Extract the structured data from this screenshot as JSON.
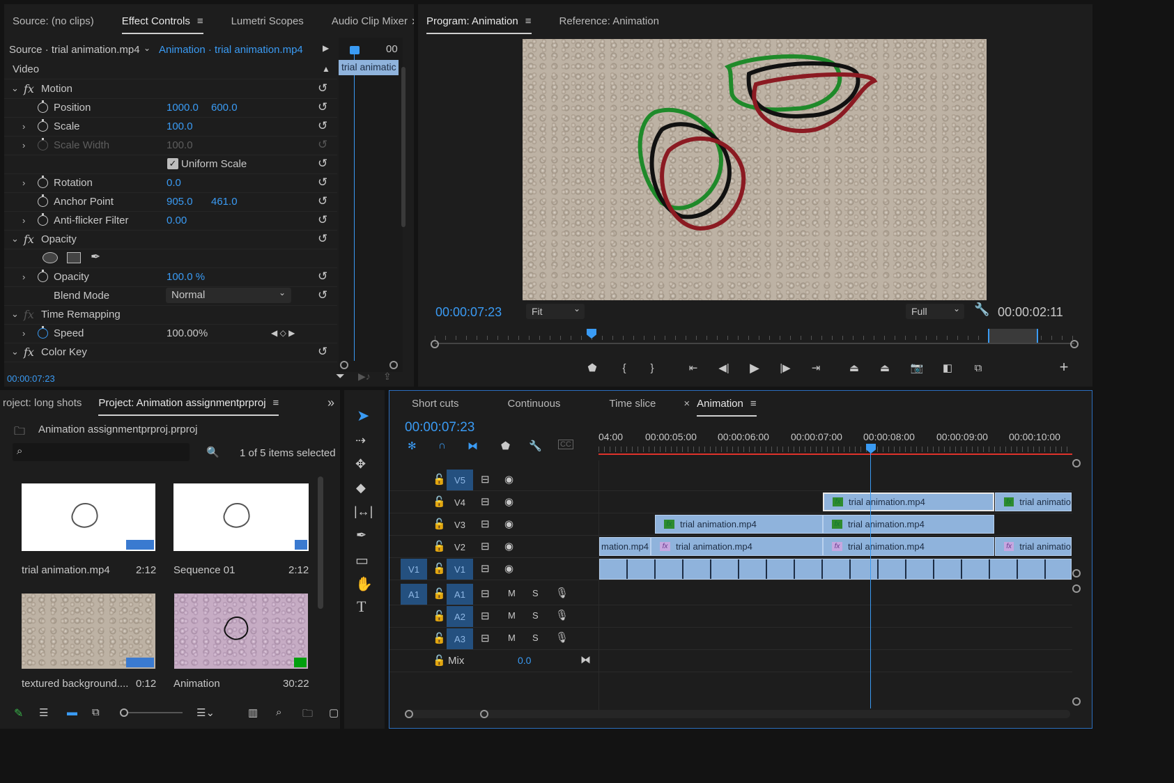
{
  "effect_panel": {
    "tabs": [
      "Source: (no clips)",
      "Effect Controls",
      "Lumetri Scopes",
      "Audio Clip Mixer"
    ],
    "overflow": "»",
    "source_label": "Source · trial animation.mp4",
    "seq_label": "Animation · trial animation.mp4",
    "mini_time": "00",
    "clip_label": "trial animatic",
    "section": "Video",
    "motion": "Motion",
    "position_label": "Position",
    "position_x": "1000.0",
    "position_y": "600.0",
    "scale_label": "Scale",
    "scale_val": "100.0",
    "scale_width_label": "Scale Width",
    "scale_width_val": "100.0",
    "uniform_label": "Uniform Scale",
    "rotation_label": "Rotation",
    "rotation_val": "0.0",
    "anchor_label": "Anchor Point",
    "anchor_x": "905.0",
    "anchor_y": "461.0",
    "antiflicker_label": "Anti-flicker Filter",
    "antiflicker_val": "0.00",
    "opacity_section": "Opacity",
    "opacity_label": "Opacity",
    "opacity_val": "100.0 %",
    "blend_label": "Blend Mode",
    "blend_val": "Normal",
    "time_remap": "Time Remapping",
    "speed_label": "Speed",
    "speed_val": "100.00%",
    "color_key": "Color Key",
    "timecode": "00:00:07:23"
  },
  "program_panel": {
    "tabs": [
      "Program: Animation",
      "Reference: Animation"
    ],
    "timecode": "00:00:07:23",
    "fit": "Fit",
    "quality": "Full",
    "duration": "00:00:02:11"
  },
  "project_panel": {
    "tabs": [
      "roject: long shots",
      "Project: Animation assignmentprproj"
    ],
    "overflow": "»",
    "file_name": "Animation assignmentprproj.prproj",
    "selected": "1 of 5 items selected",
    "items": [
      {
        "name": "trial animation.mp4",
        "duration": "2:12"
      },
      {
        "name": "Sequence 01",
        "duration": "2:12"
      },
      {
        "name": "textured background....",
        "duration": "0:12"
      },
      {
        "name": "Animation",
        "duration": "30:22"
      }
    ]
  },
  "timeline_panel": {
    "tabs": [
      "Short cuts",
      "Continuous",
      "Time slice",
      "Animation"
    ],
    "close": "×",
    "timecode": "00:00:07:23",
    "ruler": [
      "04:00",
      "00:00:05:00",
      "00:00:06:00",
      "00:00:07:00",
      "00:00:08:00",
      "00:00:09:00",
      "00:00:10:00"
    ],
    "video_tracks": [
      "V5",
      "V4",
      "V3",
      "V2",
      "V1"
    ],
    "source_v": "V1",
    "audio_tracks": [
      "A1",
      "A2",
      "A3"
    ],
    "source_a": "A1",
    "mute": "M",
    "solo": "S",
    "mix_label": "Mix",
    "mix_val": "0.0",
    "clip_name": "trial animation.mp4",
    "clip_short": "trial animatio",
    "clip_cut": "mation.mp4"
  },
  "colors": {
    "accent": "#3a9bf4",
    "clip": "#8fb3dc",
    "playhead": "#3a9bf4",
    "workarea": "#e0322b"
  }
}
